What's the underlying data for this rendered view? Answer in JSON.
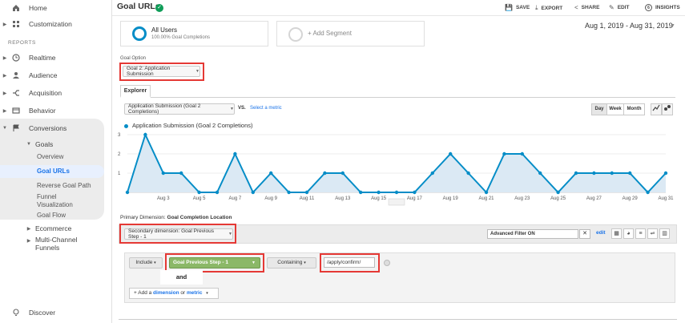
{
  "sidebar": {
    "home": "Home",
    "customization": "Customization",
    "reports_section": "REPORTS",
    "realtime": "Realtime",
    "audience": "Audience",
    "acquisition": "Acquisition",
    "behavior": "Behavior",
    "conversions": "Conversions",
    "goals": "Goals",
    "overview": "Overview",
    "goal_urls": "Goal URLs",
    "reverse_goal_path": "Reverse Goal Path",
    "funnel_visualization": "Funnel Visualization",
    "goal_flow": "Goal Flow",
    "ecommerce": "Ecommerce",
    "multi_channel_funnels": "Multi-Channel Funnels",
    "discover": "Discover"
  },
  "header": {
    "title": "Goal URLs",
    "save": "SAVE",
    "export": "EXPORT",
    "share": "SHARE",
    "edit": "EDIT",
    "insights": "INSIGHTS",
    "insights_badge": "6"
  },
  "segments": {
    "all_users": "All Users",
    "all_users_sub": "100.00% Goal Completions",
    "add_segment": "+ Add Segment"
  },
  "date_range": "Aug 1, 2019 - Aug 31, 2019",
  "goal_option": {
    "label": "Goal Option",
    "value": "Goal 2: Application Submission"
  },
  "explorer": {
    "tab": "Explorer",
    "metric": "Application Submission (Goal 2 Completions)",
    "vs": "VS.",
    "select_metric": "Select a metric",
    "day": "Day",
    "week": "Week",
    "month": "Month"
  },
  "chart_data": {
    "type": "area",
    "series": [
      {
        "name": "Application Submission (Goal 2 Completions)",
        "x": [
          "Aug 1",
          "Aug 2",
          "Aug 3",
          "Aug 4",
          "Aug 5",
          "Aug 6",
          "Aug 7",
          "Aug 8",
          "Aug 9",
          "Aug 10",
          "Aug 11",
          "Aug 12",
          "Aug 13",
          "Aug 14",
          "Aug 15",
          "Aug 16",
          "Aug 17",
          "Aug 18",
          "Aug 19",
          "Aug 20",
          "Aug 21",
          "Aug 22",
          "Aug 23",
          "Aug 24",
          "Aug 25",
          "Aug 26",
          "Aug 27",
          "Aug 28",
          "Aug 29",
          "Aug 30",
          "Aug 31"
        ],
        "values": [
          0,
          3,
          1,
          1,
          0,
          0,
          2,
          0,
          1,
          0,
          0,
          1,
          1,
          0,
          0,
          0,
          0,
          1,
          2,
          1,
          0,
          2,
          2,
          1,
          0,
          1,
          1,
          1,
          1,
          0,
          1
        ]
      }
    ],
    "xticks": [
      "Aug 3",
      "Aug 5",
      "Aug 7",
      "Aug 9",
      "Aug 11",
      "Aug 13",
      "Aug 15",
      "Aug 17",
      "Aug 19",
      "Aug 21",
      "Aug 23",
      "Aug 25",
      "Aug 27",
      "Aug 29",
      "Aug 31"
    ],
    "yticks": [
      "1",
      "2",
      "3"
    ],
    "ylim": [
      0,
      3
    ],
    "color": "#058dc7",
    "fill": "#dbe9f4"
  },
  "primary_dimension": {
    "label": "Primary Dimension:",
    "value": "Goal Completion Location"
  },
  "secondary_dimension": "Secondary dimension: Goal Previous Step - 1",
  "advanced_filter": {
    "value": "Advanced Filter ON",
    "clear": "✕",
    "edit": "edit"
  },
  "filter": {
    "include": "Include",
    "dimension": "Goal Previous Step - 1",
    "condition": "Containing",
    "value": "/apply/confirm/",
    "and": "and",
    "add_prefix": "+ Add a",
    "add_dimension": "dimension",
    "add_or": "or",
    "add_metric": "metric"
  }
}
